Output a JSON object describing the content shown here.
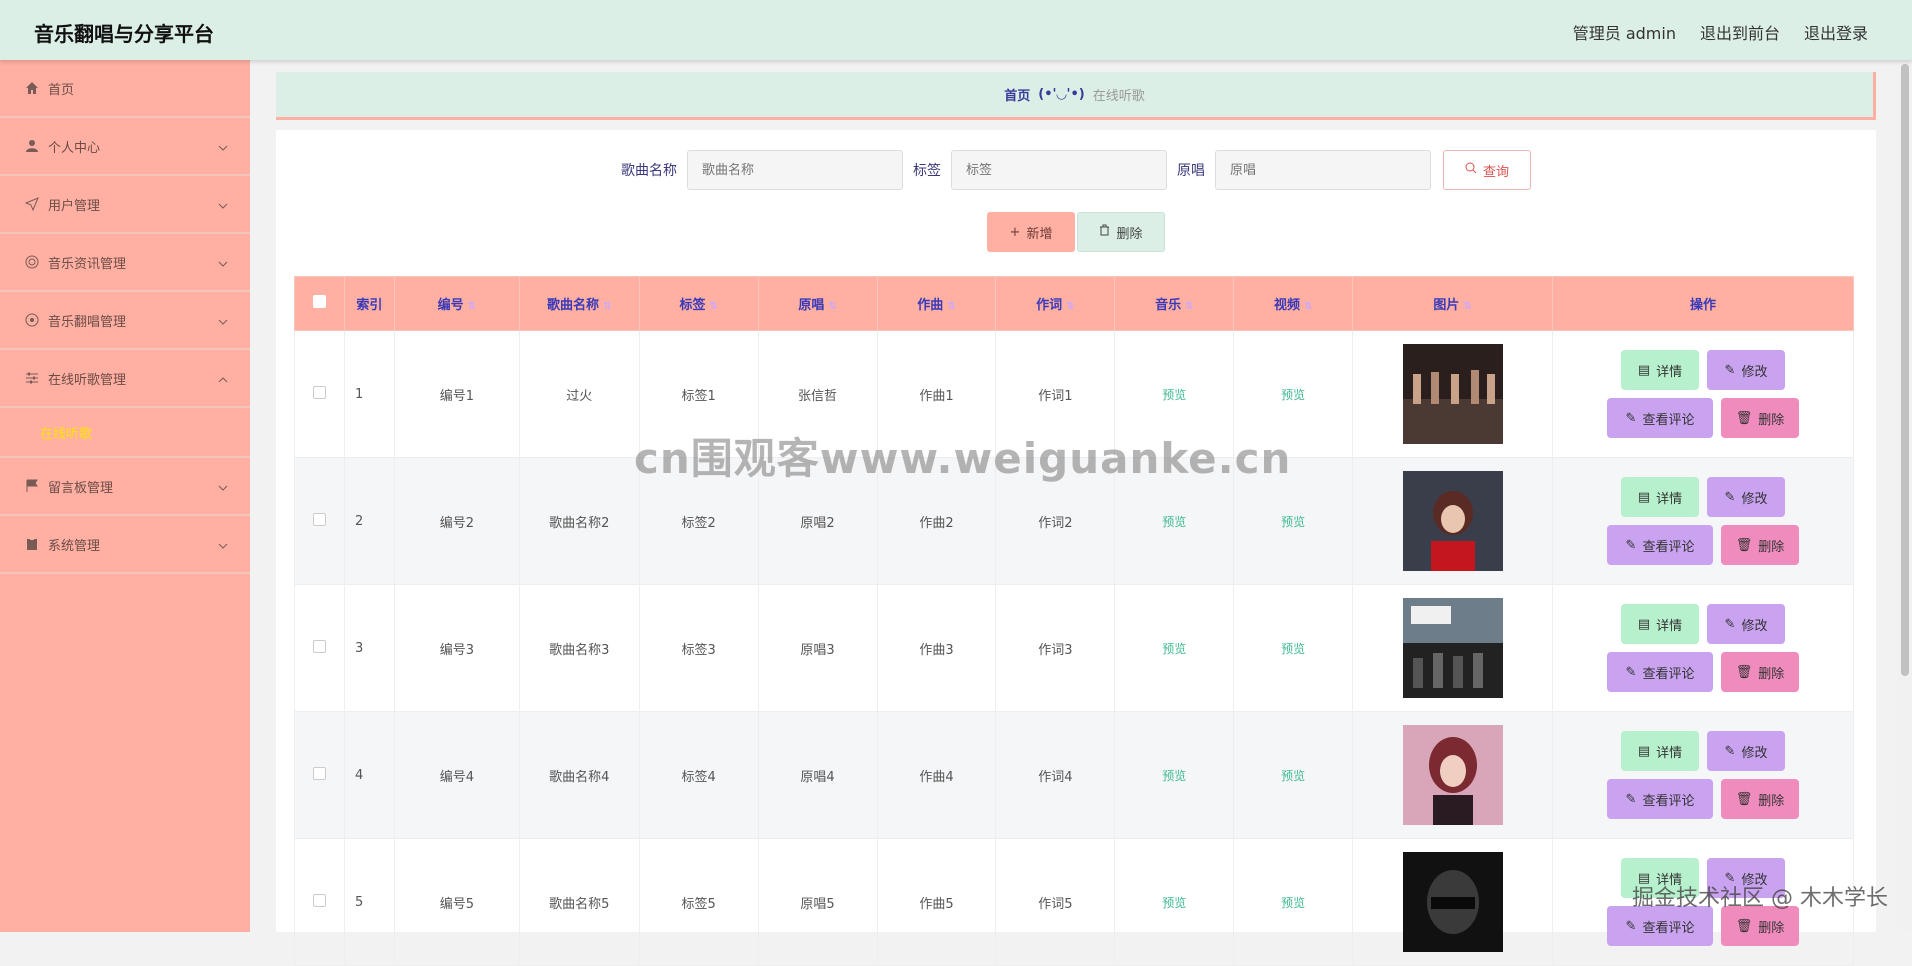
{
  "header": {
    "title": "音乐翻唱与分享平台",
    "user": "管理员 admin",
    "to_front": "退出到前台",
    "logout": "退出登录"
  },
  "sidebar": {
    "items": [
      {
        "label": "首页",
        "icon": "home-icon"
      },
      {
        "label": "个人中心",
        "icon": "user-icon"
      },
      {
        "label": "用户管理",
        "icon": "send-icon"
      },
      {
        "label": "音乐资讯管理",
        "icon": "target-icon"
      },
      {
        "label": "音乐翻唱管理",
        "icon": "chrome-icon"
      },
      {
        "label": "在线听歌管理",
        "icon": "sliders-icon"
      },
      {
        "label": "留言板管理",
        "icon": "flag-icon"
      },
      {
        "label": "系统管理",
        "icon": "clipboard-icon"
      }
    ],
    "submenu": "在线听歌"
  },
  "breadcrumb": {
    "home": "首页",
    "emoticon": "(•'◡'•)",
    "current": "在线听歌"
  },
  "search": {
    "name_label": "歌曲名称",
    "name_placeholder": "歌曲名称",
    "tag_label": "标签",
    "tag_placeholder": "标签",
    "singer_label": "原唱",
    "singer_placeholder": "原唱",
    "query_label": "查询"
  },
  "actions": {
    "add": "新增",
    "delete": "删除"
  },
  "table": {
    "headers": [
      "索引",
      "编号",
      "歌曲名称",
      "标签",
      "原唱",
      "作曲",
      "作词",
      "音乐",
      "视频",
      "图片",
      "操作"
    ],
    "rows": [
      {
        "idx": "1",
        "no": "编号1",
        "name": "过火",
        "tag": "标签1",
        "singer": "张信哲",
        "composer": "作曲1",
        "lyricist": "作词1",
        "music": "预览",
        "video": "预览"
      },
      {
        "idx": "2",
        "no": "编号2",
        "name": "歌曲名称2",
        "tag": "标签2",
        "singer": "原唱2",
        "composer": "作曲2",
        "lyricist": "作词2",
        "music": "预览",
        "video": "预览"
      },
      {
        "idx": "3",
        "no": "编号3",
        "name": "歌曲名称3",
        "tag": "标签3",
        "singer": "原唱3",
        "composer": "作曲3",
        "lyricist": "作词3",
        "music": "预览",
        "video": "预览"
      },
      {
        "idx": "4",
        "no": "编号4",
        "name": "歌曲名称4",
        "tag": "标签4",
        "singer": "原唱4",
        "composer": "作曲4",
        "lyricist": "作词4",
        "music": "预览",
        "video": "预览"
      },
      {
        "idx": "5",
        "no": "编号5",
        "name": "歌曲名称5",
        "tag": "标签5",
        "singer": "原唱5",
        "composer": "作曲5",
        "lyricist": "作词5",
        "music": "预览",
        "video": "预览"
      }
    ],
    "ops": {
      "detail": "详情",
      "edit": "修改",
      "comment": "查看评论",
      "remove": "删除"
    }
  },
  "watermark": "cn围观客www.weiguanke.cn",
  "watermark2": "掘金技术社区 @ 木木学长",
  "colors": {
    "accent": "#ffb0a3",
    "header_bg": "#dcefe6",
    "active_submenu": "#ffe400",
    "preview_link": "#3fba8f"
  }
}
